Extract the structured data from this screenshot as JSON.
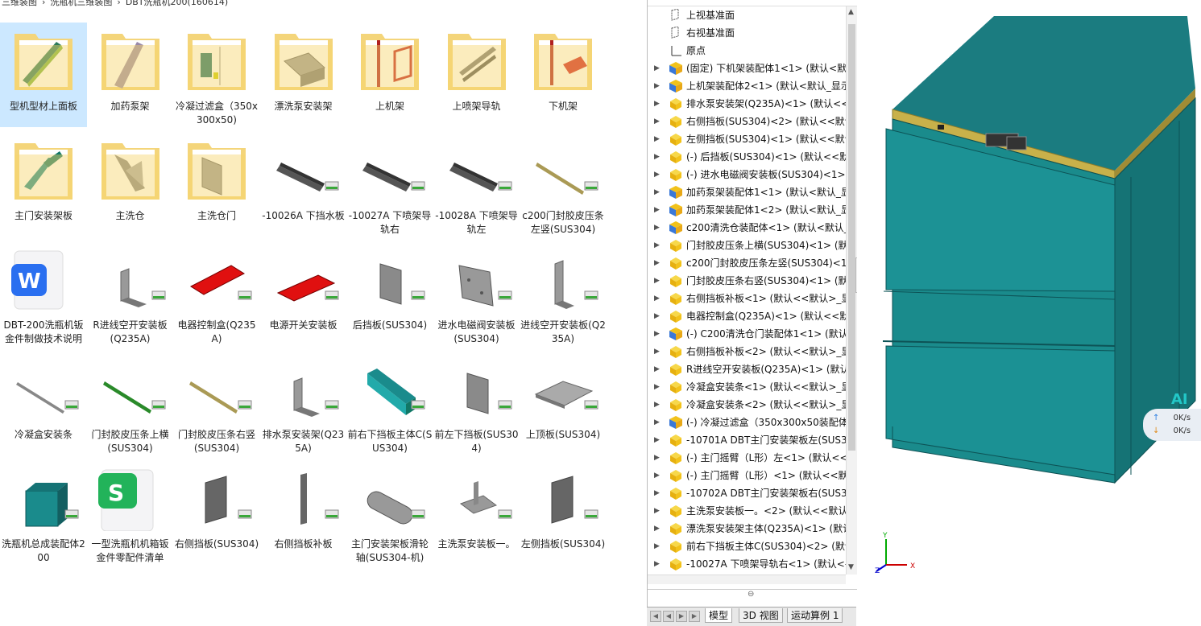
{
  "explorer": {
    "breadcrumb": [
      "三维装图",
      "洗瓶机三维装图",
      "DBT洗瓶机200(160614)"
    ],
    "files": [
      {
        "label": "型机型材上面板",
        "kind": "folder",
        "art": "rail-green",
        "selected": true
      },
      {
        "label": "加药泵架",
        "kind": "folder",
        "art": "sheet-tilt"
      },
      {
        "label": "冷凝过滤盒（350x300x50)",
        "kind": "folder",
        "art": "box-green"
      },
      {
        "label": "漂洗泵安装架",
        "kind": "folder",
        "art": "bracket-grey"
      },
      {
        "label": "上机架",
        "kind": "folder",
        "art": "frame-red"
      },
      {
        "label": "上喷架导轨",
        "kind": "folder",
        "art": "rail-grey"
      },
      {
        "label": "下机架",
        "kind": "folder",
        "art": "frame-red2"
      },
      {
        "label": "主门安装架板",
        "kind": "folder",
        "art": "bracket-teal"
      },
      {
        "label": "主洗仓",
        "kind": "folder",
        "art": "sheet-grey"
      },
      {
        "label": "主洗仓门",
        "kind": "folder",
        "art": "panel-grey"
      },
      {
        "label": "-10026A 下挡水板",
        "kind": "part",
        "art": "bar-dark"
      },
      {
        "label": "-10027A 下喷架导轨右",
        "kind": "part",
        "art": "bar-dark"
      },
      {
        "label": "-10028A 下喷架导轨左",
        "kind": "part",
        "art": "bar-dark"
      },
      {
        "label": "c200门封胶皮压条左竖(SUS304)",
        "kind": "part",
        "art": "bar-olive"
      },
      {
        "label": "DBT-200洗瓶机钣金件制做技术说明",
        "kind": "wps-doc",
        "art": "wps"
      },
      {
        "label": "R进线空开安装板(Q235A)",
        "kind": "part",
        "art": "angle-grey"
      },
      {
        "label": "电器控制盒(Q235A)",
        "kind": "part",
        "art": "tray-red"
      },
      {
        "label": "电源开关安装板",
        "kind": "part",
        "art": "plate-red"
      },
      {
        "label": "后挡板(SUS304)",
        "kind": "part",
        "art": "plate-grey"
      },
      {
        "label": "进水电磁阀安装板(SUS304)",
        "kind": "part",
        "art": "plate-holes"
      },
      {
        "label": "进线空开安装板(Q235A)",
        "kind": "part",
        "art": "angle-grey2"
      },
      {
        "label": "冷凝盒安装条",
        "kind": "part",
        "art": "bar-thin"
      },
      {
        "label": "门封胶皮压条上横(SUS304)",
        "kind": "part",
        "art": "bar-green"
      },
      {
        "label": "门封胶皮压条右竖(SUS304)",
        "kind": "part",
        "art": "bar-olive"
      },
      {
        "label": "排水泵安装架(Q235A)",
        "kind": "part",
        "art": "angle-grey"
      },
      {
        "label": "前右下挡板主体C(SUS304)",
        "kind": "part",
        "art": "channel-teal"
      },
      {
        "label": "前左下挡板(SUS304)",
        "kind": "part",
        "art": "plate-grey"
      },
      {
        "label": "上顶板(SUS304)",
        "kind": "part",
        "art": "top-plate"
      },
      {
        "label": "洗瓶机总成装配体200",
        "kind": "assembly",
        "art": "machine"
      },
      {
        "label": "一型洗瓶机机箱钣金件零配件清单",
        "kind": "wps-sheet",
        "art": "wps-s"
      },
      {
        "label": "右侧挡板(SUS304)",
        "kind": "part",
        "art": "panel-dark"
      },
      {
        "label": "右侧挡板补板",
        "kind": "part",
        "art": "strip-dark"
      },
      {
        "label": "主门安装架板滑轮轴(SUS304-机)",
        "kind": "part",
        "art": "shaft"
      },
      {
        "label": "主洗泵安装板一。",
        "kind": "part",
        "art": "bracket-small"
      },
      {
        "label": "左侧挡板(SUS304)",
        "kind": "part",
        "art": "panel-dark"
      }
    ]
  },
  "feature_manager": {
    "rows": [
      {
        "label": "上视基准面",
        "icon": "plane",
        "expand": false
      },
      {
        "label": "右视基准面",
        "icon": "plane",
        "expand": false
      },
      {
        "label": "原点",
        "icon": "origin",
        "expand": false
      },
      {
        "label": "(固定) 下机架装配体1<1> (默认<默",
        "icon": "assembly",
        "expand": true
      },
      {
        "label": "上机架装配体2<1> (默认<默认_显示",
        "icon": "assembly",
        "expand": true
      },
      {
        "label": "排水泵安装架(Q235A)<1> (默认<<",
        "icon": "part",
        "expand": true
      },
      {
        "label": "右侧挡板(SUS304)<2> (默认<<默认",
        "icon": "part",
        "expand": true
      },
      {
        "label": "左侧挡板(SUS304)<1> (默认<<默认",
        "icon": "part",
        "expand": true
      },
      {
        "label": "(-) 后挡板(SUS304)<1> (默认<<默",
        "icon": "part",
        "expand": true
      },
      {
        "label": "(-) 进水电磁阀安装板(SUS304)<1>",
        "icon": "part",
        "expand": true
      },
      {
        "label": "加药泵架装配体1<1> (默认<默认_显",
        "icon": "assembly",
        "expand": true
      },
      {
        "label": "加药泵架装配体1<2> (默认<默认_显",
        "icon": "assembly",
        "expand": true
      },
      {
        "label": "c200清洗仓装配体<1> (默认<默认_",
        "icon": "assembly",
        "expand": true
      },
      {
        "label": "门封胶皮压条上横(SUS304)<1> (默",
        "icon": "part",
        "expand": true
      },
      {
        "label": "c200门封胶皮压条左竖(SUS304)<1",
        "icon": "part",
        "expand": true
      },
      {
        "label": "门封胶皮压条右竖(SUS304)<1> (默",
        "icon": "part",
        "expand": true
      },
      {
        "label": "右侧挡板补板<1> (默认<<默认>_显",
        "icon": "part",
        "expand": true
      },
      {
        "label": "电器控制盒(Q235A)<1> (默认<<默",
        "icon": "part",
        "expand": true
      },
      {
        "label": "(-) C200清洗仓门装配体1<1> (默认",
        "icon": "assembly",
        "expand": true
      },
      {
        "label": "右侧挡板补板<2> (默认<<默认>_显",
        "icon": "part",
        "expand": true
      },
      {
        "label": "R进线空开安装板(Q235A)<1> (默认",
        "icon": "part",
        "expand": true
      },
      {
        "label": "冷凝盒安装条<1> (默认<<默认>_显",
        "icon": "part",
        "expand": true
      },
      {
        "label": "冷凝盒安装条<2> (默认<<默认>_显",
        "icon": "part",
        "expand": true
      },
      {
        "label": "(-) 冷凝过滤盒（350x300x50装配体",
        "icon": "assembly",
        "expand": true
      },
      {
        "label": "-10701A DBT主门安装架板左(SUS3",
        "icon": "part",
        "expand": true
      },
      {
        "label": "(-) 主门摇臂（L形）左<1> (默认<<",
        "icon": "part",
        "expand": true
      },
      {
        "label": "(-) 主门摇臂（L形）<1> (默认<<默",
        "icon": "part",
        "expand": true
      },
      {
        "label": "-10702A DBT主门安装架板右(SUS3",
        "icon": "part",
        "expand": true
      },
      {
        "label": "主洗泵安装板一。<2> (默认<<默认",
        "icon": "part",
        "expand": true
      },
      {
        "label": "漂洗泵安装架主体(Q235A)<1> (默认",
        "icon": "part",
        "expand": true
      },
      {
        "label": "前右下挡板主体C(SUS304)<2> (默认",
        "icon": "part",
        "expand": true
      },
      {
        "label": "-10027A 下喷架导轨右<1> (默认<-",
        "icon": "part",
        "expand": true
      }
    ],
    "tabs": [
      "模型",
      "3D 视图",
      "运动算例 1"
    ],
    "active_tab": "模型"
  },
  "network_widget": {
    "badge": "AI",
    "upload": "0K/s",
    "download": "0K/s",
    "up_icon": "arrow-up-icon",
    "down_icon": "arrow-down-icon"
  },
  "triad_labels": {
    "y": "Y",
    "x": "X",
    "z": "Z"
  },
  "colors": {
    "teal": "#1f8a8a",
    "gold": "#c8b14a",
    "tree_yellow": "#f2c21a",
    "selection": "#cce8ff"
  }
}
